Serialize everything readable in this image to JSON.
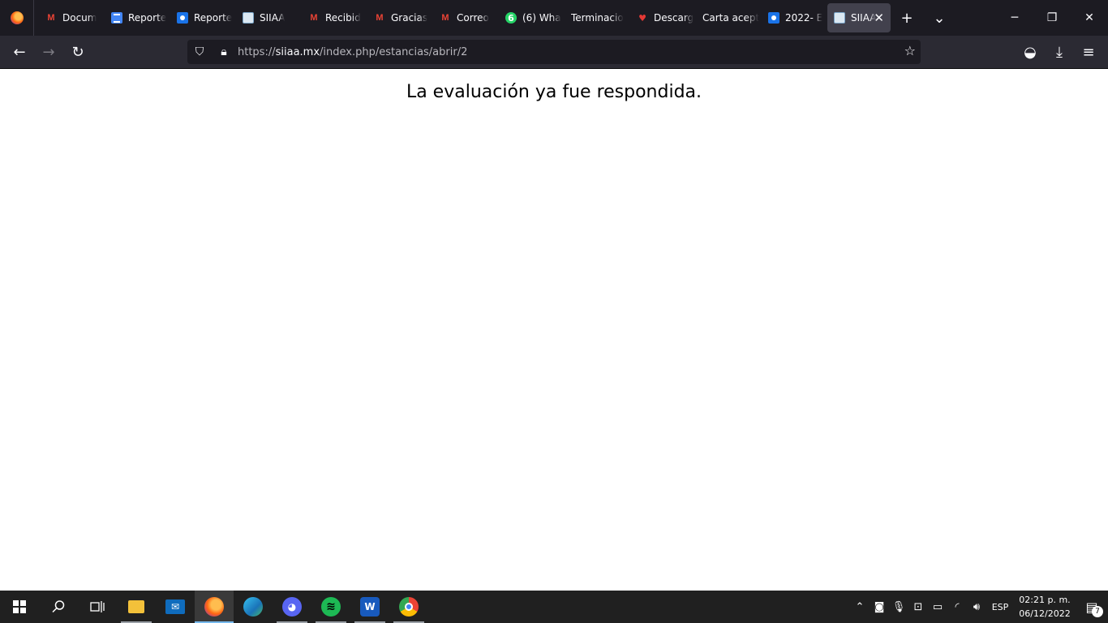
{
  "browser": {
    "tabs": [
      {
        "label": "Docum",
        "icon": "gmail-icon"
      },
      {
        "label": "Reporte",
        "icon": "google-docs-icon"
      },
      {
        "label": "Reporte",
        "icon": "google-classroom-icon"
      },
      {
        "label": "SIIAA",
        "icon": "siiaa-icon"
      },
      {
        "label": "Recibid",
        "icon": "gmail-icon"
      },
      {
        "label": "Gracias",
        "icon": "gmail-icon"
      },
      {
        "label": "Correo",
        "icon": "gmail-icon"
      },
      {
        "label": "(6) Wha",
        "icon": "whatsapp-icon",
        "badge": "6"
      },
      {
        "label": "Terminacio",
        "icon": "none"
      },
      {
        "label": "Descarg",
        "icon": "heart-icon"
      },
      {
        "label": "Carta acept",
        "icon": "none"
      },
      {
        "label": "2022- E",
        "icon": "google-classroom-icon"
      },
      {
        "label": "SIIAA",
        "icon": "siiaa-icon",
        "active": true
      }
    ],
    "url_prefix": "https://",
    "url_host": "siiaa.mx",
    "url_path": "/index.php/estancias/abrir/2"
  },
  "page": {
    "message": "La evaluación ya fue respondida."
  },
  "taskbar": {
    "apps": [
      "start-icon",
      "search-icon",
      "task-view-icon",
      "file-explorer-icon",
      "mail-icon",
      "firefox-icon",
      "edge-icon",
      "discord-icon",
      "spotify-icon",
      "word-icon",
      "chrome-icon"
    ],
    "language": "ESP",
    "time": "02:21 p. m.",
    "date": "06/12/2022",
    "notification_count": "7"
  }
}
